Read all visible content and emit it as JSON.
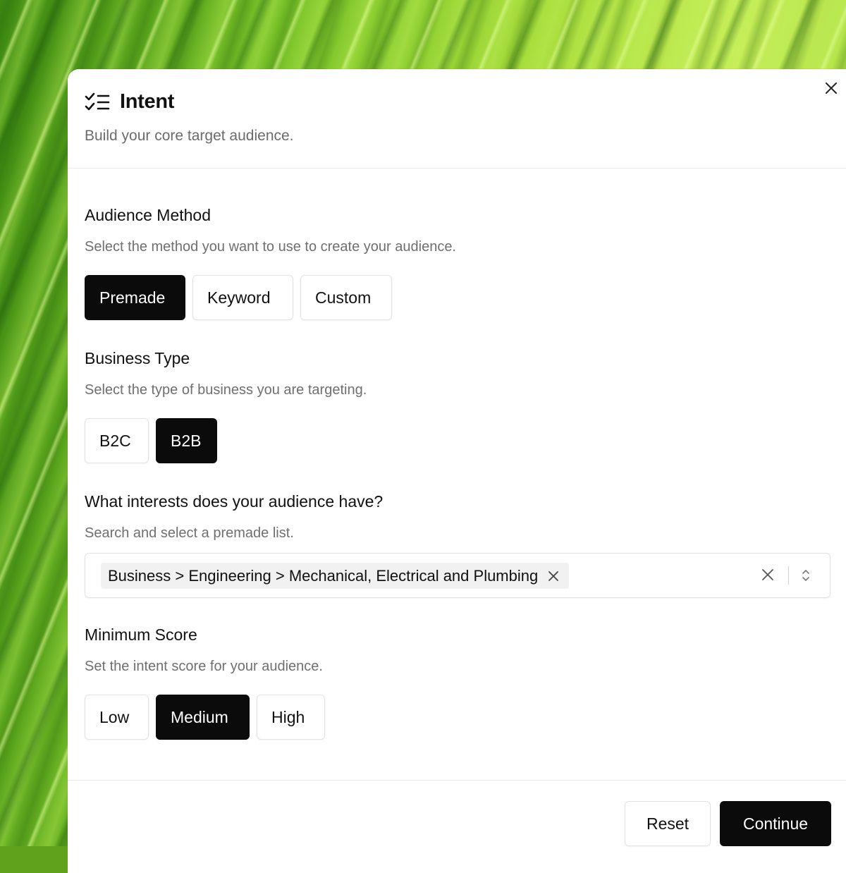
{
  "dialog": {
    "title": "Intent",
    "subtitle": "Build your core target audience.",
    "icon": "list-checks-icon"
  },
  "audience_method": {
    "title": "Audience Method",
    "description": "Select the method you want to use to create your audience.",
    "options": [
      "Premade",
      "Keyword",
      "Custom"
    ],
    "selected": "Premade"
  },
  "business_type": {
    "title": "Business Type",
    "description": "Select the type of business you are targeting.",
    "options": [
      "B2C",
      "B2B"
    ],
    "selected": "B2B"
  },
  "interests": {
    "title": "What interests does your audience have?",
    "description": "Search and select a premade list.",
    "selected_chip": "Business > Engineering > Mechanical, Electrical and Plumbing"
  },
  "minimum_score": {
    "title": "Minimum Score",
    "description": "Set the intent score for your audience.",
    "options": [
      "Low",
      "Medium",
      "High"
    ],
    "selected": "Medium"
  },
  "footer": {
    "reset_label": "Reset",
    "continue_label": "Continue"
  },
  "colors": {
    "primary": "#0b0b0b",
    "muted_text": "#6b6b6b",
    "border": "#e2e2e2",
    "background_accent": "#7cc42a"
  }
}
